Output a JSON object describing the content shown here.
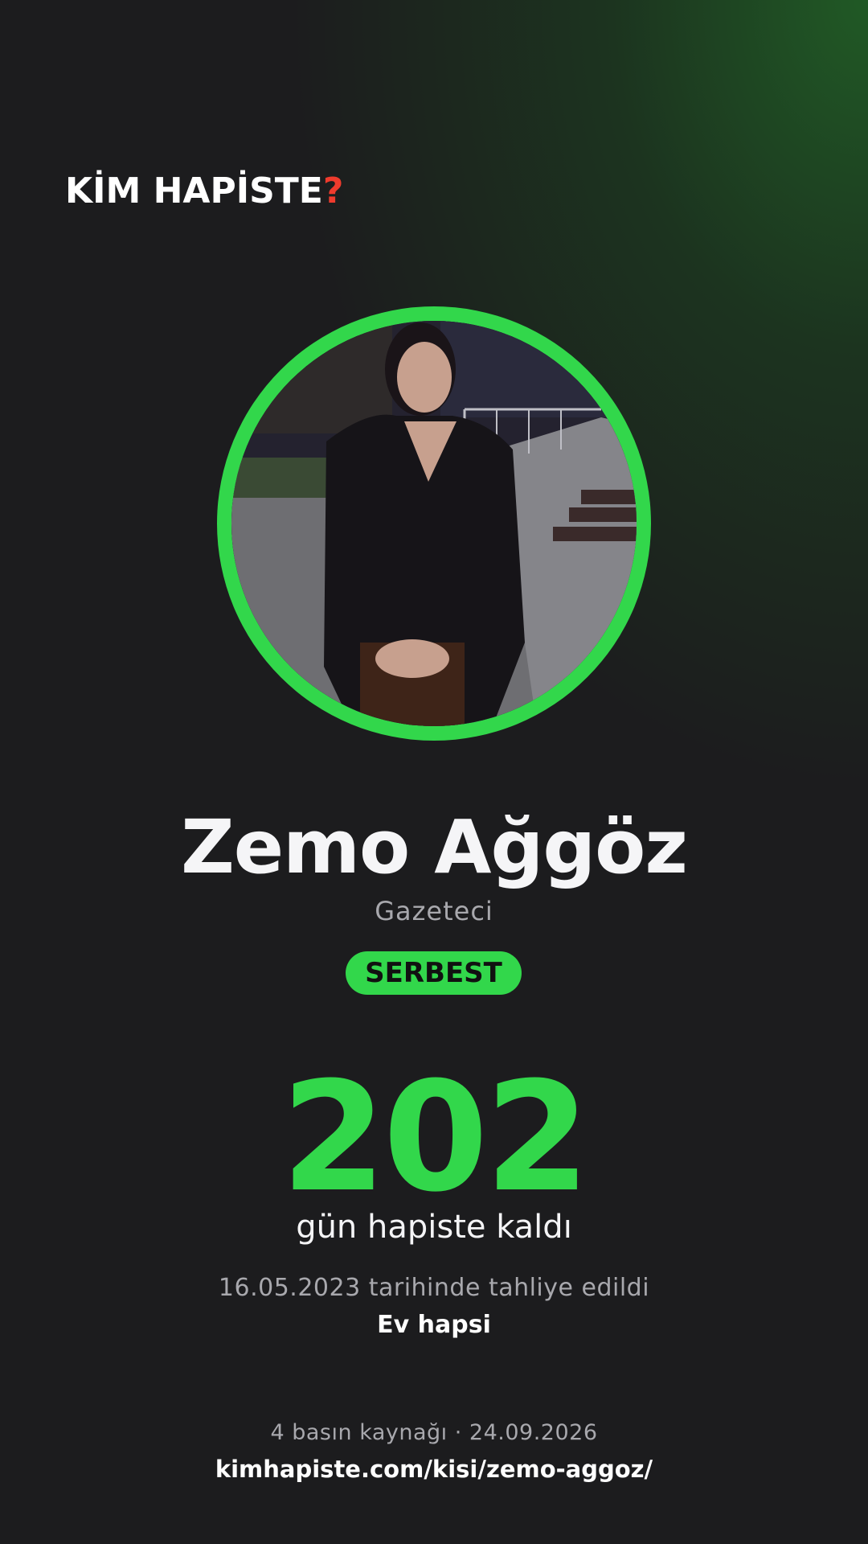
{
  "brand": {
    "logo_text": "KİM HAPİSTE",
    "logo_mark": "?",
    "accent_color": "#32d74b",
    "mark_color": "#ef3b2d"
  },
  "profile": {
    "name": "Zemo Ağgöz",
    "role": "Gazeteci",
    "status_badge": "SERBEST",
    "photo_icon": "person-photo"
  },
  "stats": {
    "days_count": "202",
    "days_label": "gün hapiste kaldı",
    "release_text": "16.05.2023 tarihinde tahliye edildi",
    "detention_type": "Ev hapsi"
  },
  "footer": {
    "sources": "4 basın kaynağı · 24.09.2026",
    "url": "kimhapiste.com/kisi/zemo-aggoz/"
  }
}
